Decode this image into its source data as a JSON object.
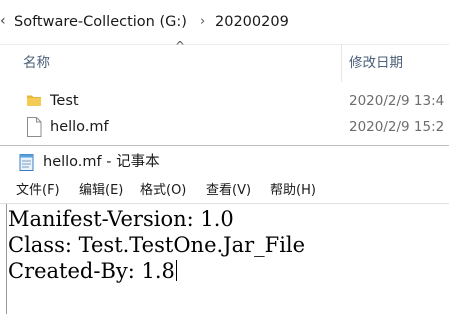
{
  "explorer": {
    "breadcrumb": {
      "chevron": "‹",
      "items": [
        "Software-Collection (G:)",
        "20200209"
      ],
      "separator": "›"
    },
    "columns": {
      "name": "名称",
      "modified": "修改日期",
      "sort_indicator": "^"
    },
    "files": [
      {
        "name": "Test",
        "date": "2020/2/9 13:4",
        "icon": "folder-icon"
      },
      {
        "name": "hello.mf",
        "date": "2020/2/9 15:2",
        "icon": "document-icon"
      }
    ]
  },
  "notepad": {
    "title": "hello.mf - 记事本",
    "menu": [
      "文件(F)",
      "编辑(E)",
      "格式(O)",
      "查看(V)",
      "帮助(H)"
    ],
    "lines": [
      "Manifest-Version: 1.0",
      "Class: Test.TestOne.Jar_File",
      "Created-By: 1.8"
    ]
  },
  "colors": {
    "folder": "#f0c341",
    "column_header_text": "#4c607a",
    "date_text": "#6d6d6d"
  }
}
